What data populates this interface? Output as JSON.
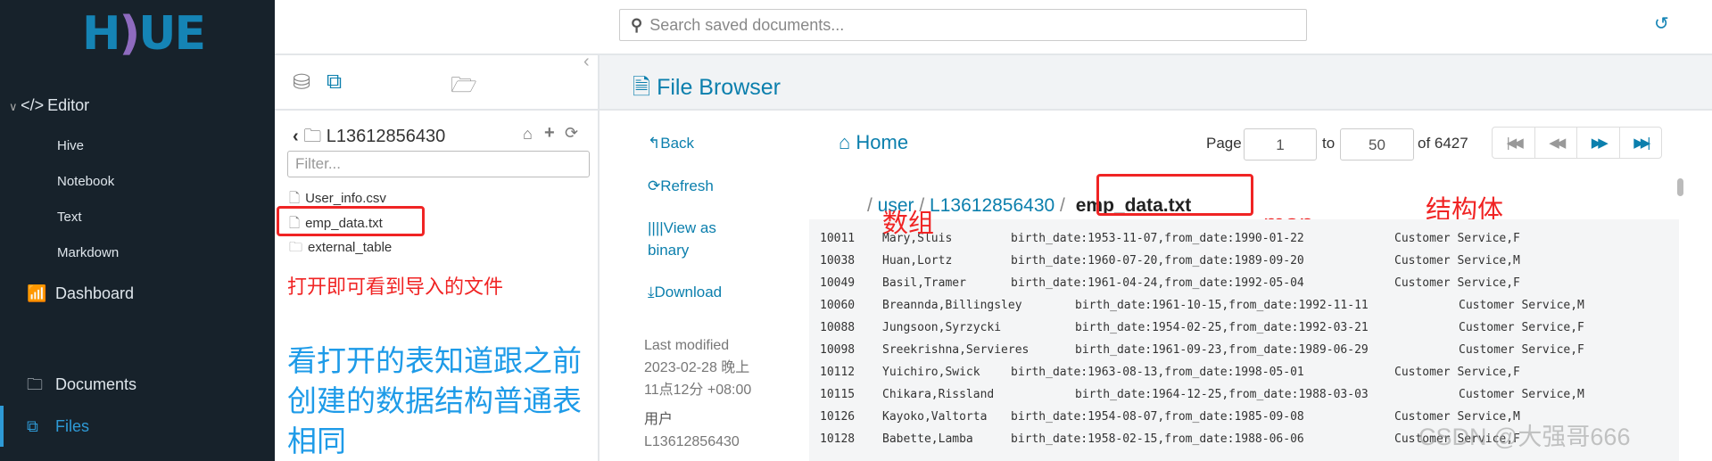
{
  "sidebar": {
    "logo": "HUE",
    "items": [
      {
        "label": "Editor",
        "icon": "code-icon"
      },
      {
        "label": "Hive"
      },
      {
        "label": "Notebook"
      },
      {
        "label": "Text"
      },
      {
        "label": "Markdown"
      },
      {
        "label": "Dashboard",
        "icon": "chart-icon"
      },
      {
        "label": "Documents",
        "icon": "documents-icon"
      },
      {
        "label": "Files",
        "icon": "files-icon",
        "active": true
      }
    ]
  },
  "topbar": {
    "search_placeholder": "Search saved documents..."
  },
  "panel": {
    "folder": "L13612856430",
    "filter_placeholder": "Filter...",
    "files": [
      {
        "name": "User_info.csv",
        "type": "file"
      },
      {
        "name": "emp_data.txt",
        "type": "file"
      },
      {
        "name": "external_table",
        "type": "folder"
      }
    ]
  },
  "main": {
    "title": "File Browser",
    "actions": {
      "back": "Back",
      "refresh": "Refresh",
      "view_binary_1": "View as",
      "view_binary_2": "binary",
      "download": "Download"
    },
    "meta": {
      "last_modified_label": "Last modified",
      "date_1": "2023-02-28 晚上",
      "date_2": "11点12分 +08:00",
      "user_label": "用户",
      "user": "L13612856430"
    },
    "home": "Home",
    "paging": {
      "page_label": "Page",
      "from": "1",
      "to_label": "to",
      "to": "50",
      "of": "of 6427"
    },
    "path": [
      "user",
      "L13612856430",
      "emp_data.txt"
    ],
    "rows": [
      [
        "10011",
        "Mary,Sluis",
        "birth_date:1953-11-07,from_date:1990-01-22",
        "Customer Service,F"
      ],
      [
        "10038",
        "Huan,Lortz",
        "birth_date:1960-07-20,from_date:1989-09-20",
        "Customer Service,M"
      ],
      [
        "10049",
        "Basil,Tramer",
        "birth_date:1961-04-24,from_date:1992-05-04",
        "Customer Service,F"
      ],
      [
        "10060",
        "Breannda,Billingsley",
        "birth_date:1961-10-15,from_date:1992-11-11",
        "Customer Service,M"
      ],
      [
        "10088",
        "Jungsoon,Syrzycki",
        "birth_date:1954-02-25,from_date:1992-03-21",
        "Customer Service,F"
      ],
      [
        "10098",
        "Sreekrishna,Servieres",
        "birth_date:1961-09-23,from_date:1989-06-29",
        "Customer Service,F"
      ],
      [
        "10112",
        "Yuichiro,Swick",
        "birth_date:1963-08-13,from_date:1998-05-01",
        "Customer Service,F"
      ],
      [
        "10115",
        "Chikara,Rissland",
        "birth_date:1964-12-25,from_date:1988-03-03",
        "Customer Service,M"
      ],
      [
        "10126",
        "Kayoko,Valtorta",
        "birth_date:1954-08-07,from_date:1985-09-08",
        "Customer Service,M"
      ],
      [
        "10128",
        "Babette,Lamba",
        "birth_date:1958-02-15,from_date:1988-06-06",
        "Customer Service,F"
      ]
    ]
  },
  "annotations": {
    "open_note": "打开即可看到导入的文件",
    "compare_note": [
      "看打开的表知道跟之前",
      "创建的数据结构普通表",
      "相同"
    ],
    "array": "数组",
    "map": "map",
    "struct": "结构体"
  },
  "watermark": "CSDN @大强哥666",
  "colors": {
    "sidebar": "#17222b",
    "accent": "#0b7fad",
    "annotation_red": "#f02424",
    "annotation_blue": "#1e9be8"
  }
}
